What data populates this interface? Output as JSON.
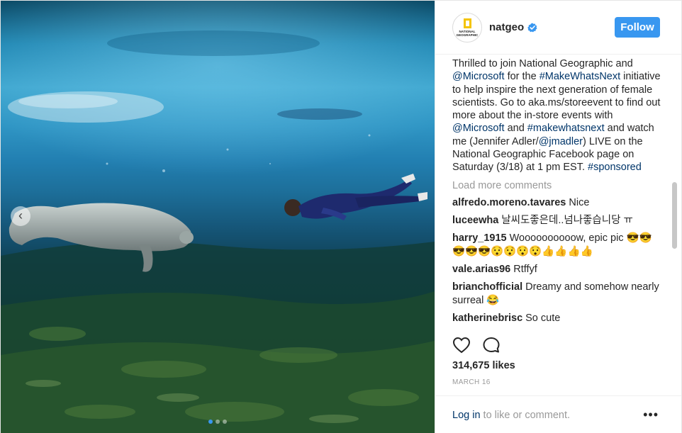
{
  "post": {
    "username": "natgeo",
    "verified": true,
    "avatar_text": "NATIONAL GEOGRAPHIC",
    "follow_label": "Follow",
    "caption": {
      "parts": [
        "Thrilled to join National Geographic and ",
        "@Microsoft",
        " for the ",
        "#MakeWhatsNext",
        " initiative to help inspire the next generation of female scientists. Go to aka.ms/storeevent to find out more about the in-store events with ",
        "@Microsoft",
        " and ",
        "#makewhatsnext",
        " and watch me (Jennifer Adler/",
        "@jmadler",
        ") LIVE on the National Geographic Facebook page on Saturday (3/18) at 1 pm EST. ",
        "#sponsored"
      ]
    },
    "load_more_label": "Load more comments",
    "comments": [
      {
        "user": "alfredo.moreno.tavares",
        "text": "Nice"
      },
      {
        "user": "luceewha",
        "text": "날씨도좋은데..넘나좋습니당 ㅠ"
      },
      {
        "user": "harry_1915",
        "text": "Woooooooooow, epic pic 😎😎😎😎😎😯😯😯😯👍👍👍👍"
      },
      {
        "user": "vale.arias96",
        "text": "Rtffyf"
      },
      {
        "user": "brianchofficial",
        "text": "Dreamy and somehow nearly surreal 😂"
      },
      {
        "user": "katherinebrisc",
        "text": "So cute"
      }
    ],
    "likes": "314,675 likes",
    "date": "MARCH 16",
    "footer": {
      "login_label": "Log in",
      "suffix": " to like or comment.",
      "more_label": "•••"
    },
    "icons": {
      "like": "heart-icon",
      "comment": "comment-icon",
      "carousel_prev": "chevron-left-icon"
    },
    "colors": {
      "accent": "#3897f0",
      "link": "#003569",
      "muted": "#999999"
    }
  }
}
